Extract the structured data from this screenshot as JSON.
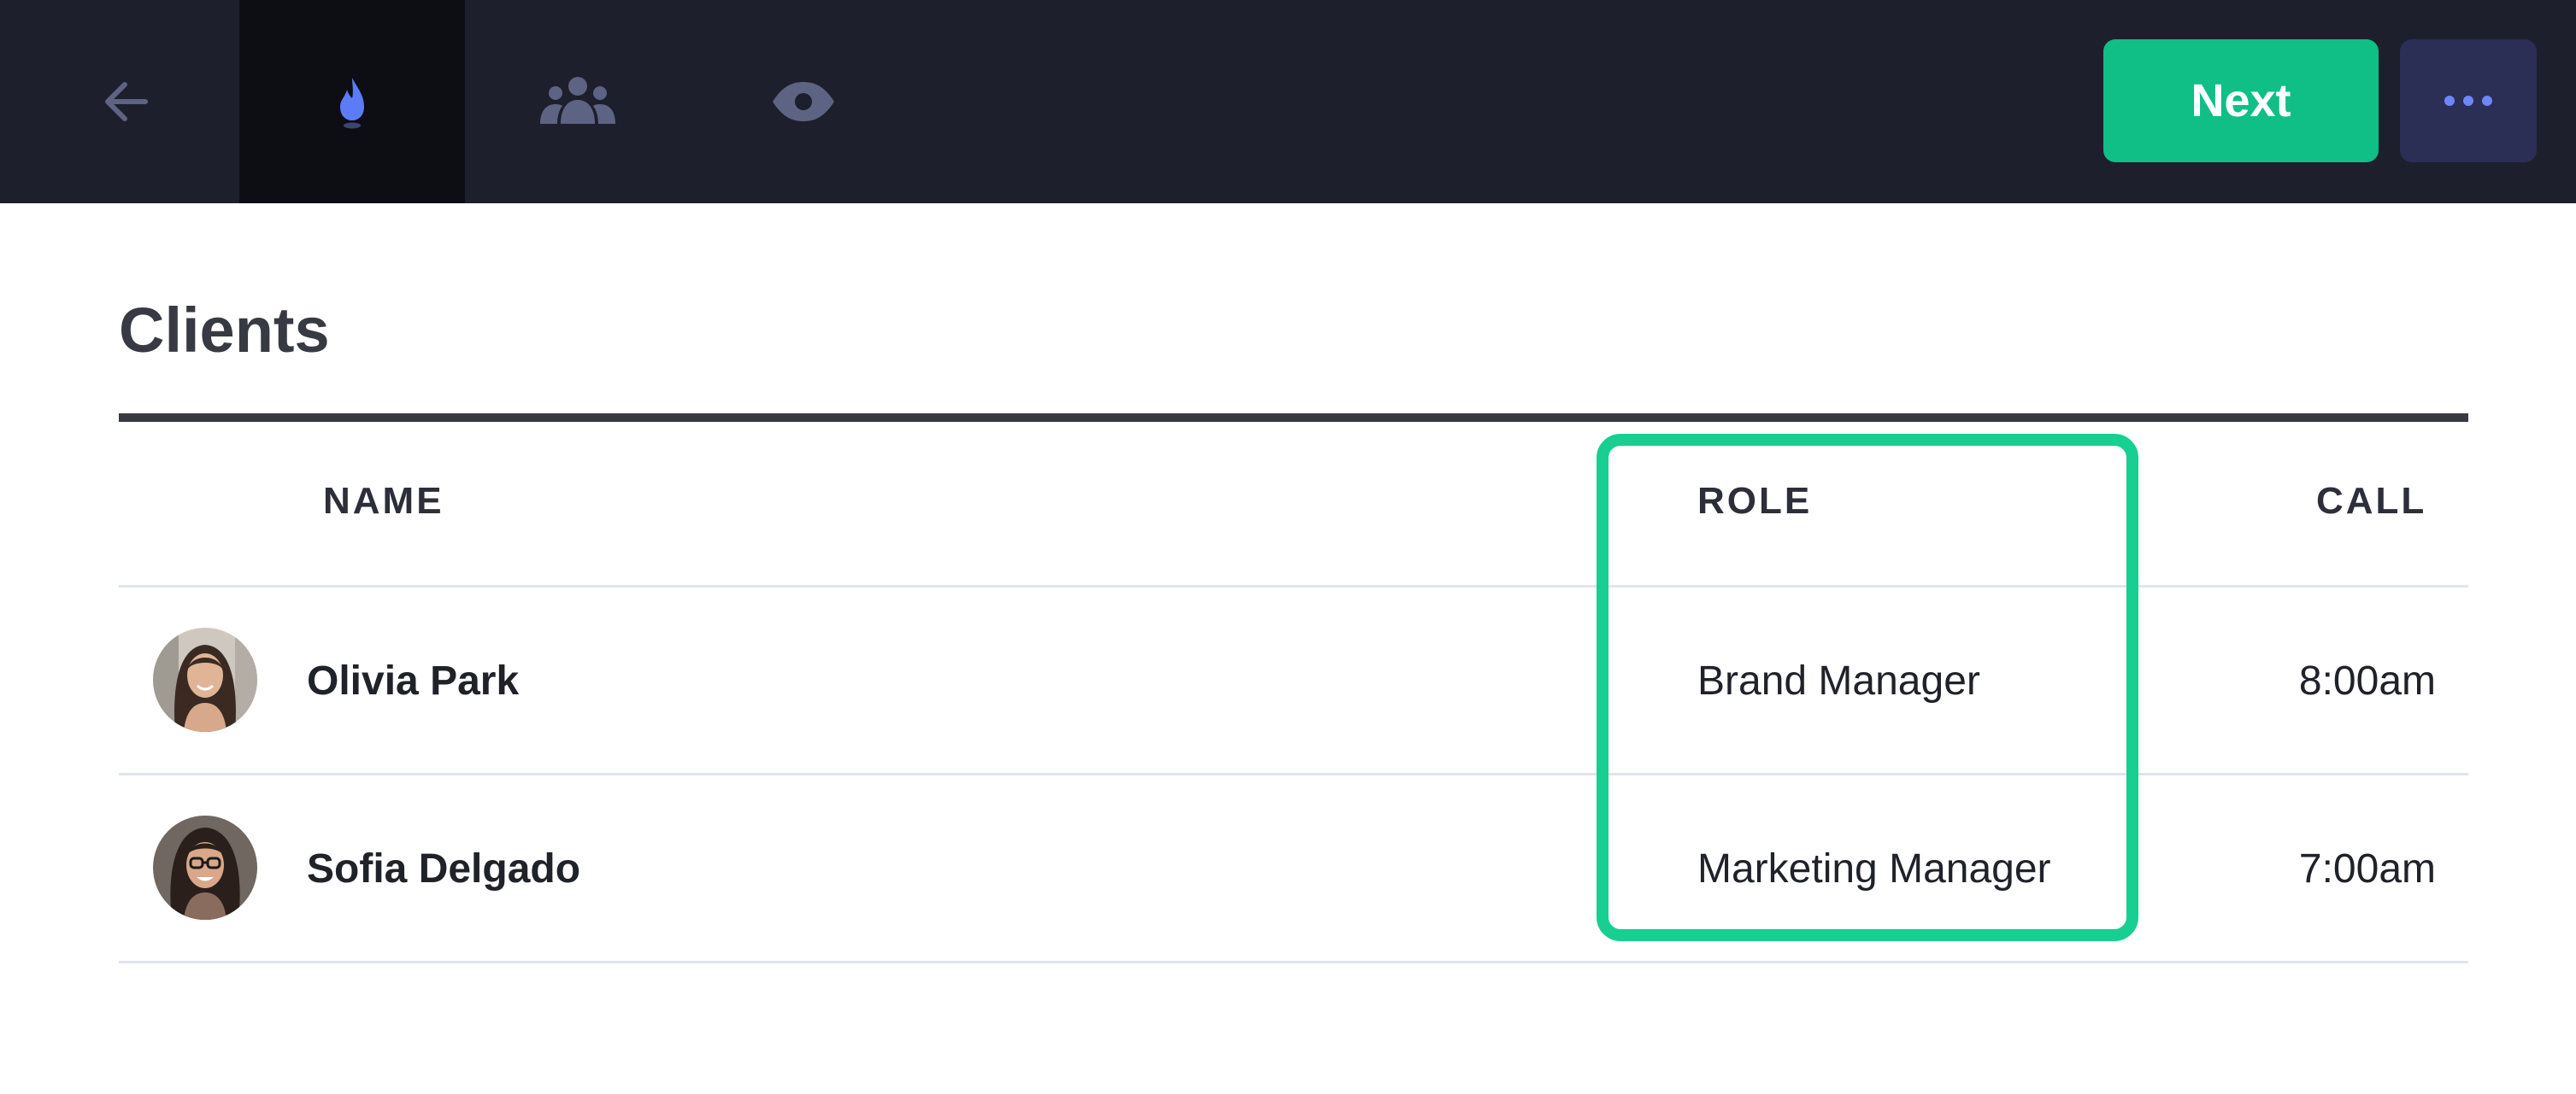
{
  "header": {
    "nav": [
      {
        "icon": "arrow-left-icon"
      },
      {
        "icon": "flame-icon",
        "active": true
      },
      {
        "icon": "people-icon"
      },
      {
        "icon": "eye-icon"
      }
    ],
    "next_label": "Next",
    "more_icon": "ellipsis-icon"
  },
  "colors": {
    "topbar": "#1e1f2c",
    "active_tab": "#0d0d14",
    "accent": "#0fbf86",
    "highlight": "#16cf91",
    "more_button": "#2b2e55",
    "icon_muted": "#5d6382",
    "icon_active": "#5b7cf6"
  },
  "page": {
    "title": "Clients"
  },
  "table": {
    "columns": {
      "name": "NAME",
      "role": "ROLE",
      "call": "CALL"
    },
    "rows": [
      {
        "name": "Olivia Park",
        "role": "Brand Manager",
        "call": "8:00am"
      },
      {
        "name": "Sofia Delgado",
        "role": "Marketing Manager",
        "call": "7:00am"
      }
    ]
  }
}
